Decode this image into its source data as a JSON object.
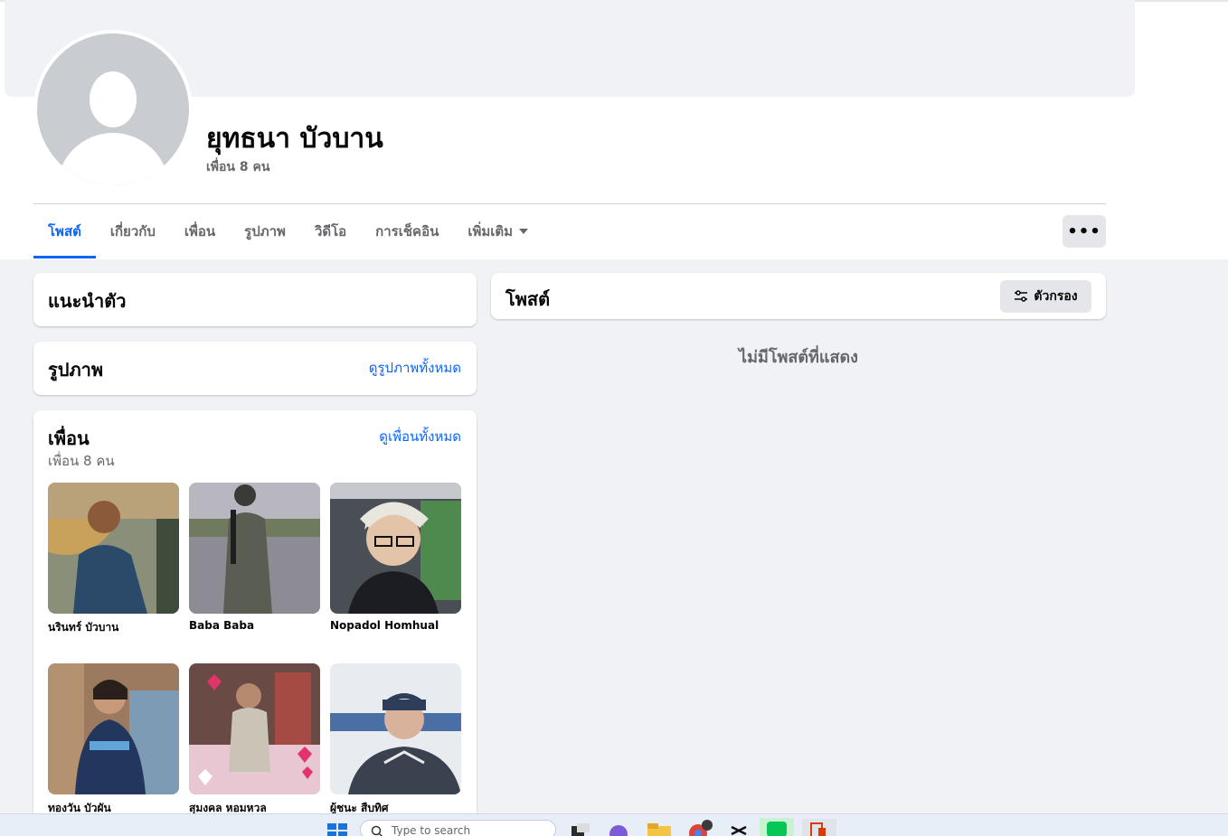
{
  "profile": {
    "name": "ยุทธนา บัวบาน",
    "friends_count": "เพื่อน 8 คน"
  },
  "tabs": [
    {
      "label": "โพสต์",
      "active": true
    },
    {
      "label": "เกี่ยวกับ",
      "active": false
    },
    {
      "label": "เพื่อน",
      "active": false
    },
    {
      "label": "รูปภาพ",
      "active": false
    },
    {
      "label": "วิดีโอ",
      "active": false
    },
    {
      "label": "การเช็คอิน",
      "active": false
    },
    {
      "label": "เพิ่มเติม",
      "active": false
    }
  ],
  "more_button": "•••",
  "intro": {
    "title": "แนะนำตัว"
  },
  "photos": {
    "title": "รูปภาพ",
    "see_all": "ดูรูปภาพทั้งหมด"
  },
  "friends": {
    "title": "เพื่อน",
    "subtitle": "เพื่อน 8 คน",
    "see_all": "ดูเพื่อนทั้งหมด",
    "list": [
      {
        "name": "นรินทร์ บัวบาน"
      },
      {
        "name": "Baba Baba"
      },
      {
        "name": "Nopadol Homhual"
      },
      {
        "name": "ทองวัน บัวผัน"
      },
      {
        "name": "สุมงคล หอมหวล"
      },
      {
        "name": "ผู้ชนะ สืบทิศ"
      }
    ]
  },
  "posts": {
    "title": "โพสต์",
    "filter_label": "ตัวกรอง",
    "empty_text": "ไม่มีโพสต์ที่แสดง"
  },
  "taskbar": {
    "search_placeholder": "Type to search"
  },
  "colors": {
    "accent": "#0866ff",
    "secondary_text": "#65676b",
    "page_bg": "#f0f2f5"
  }
}
